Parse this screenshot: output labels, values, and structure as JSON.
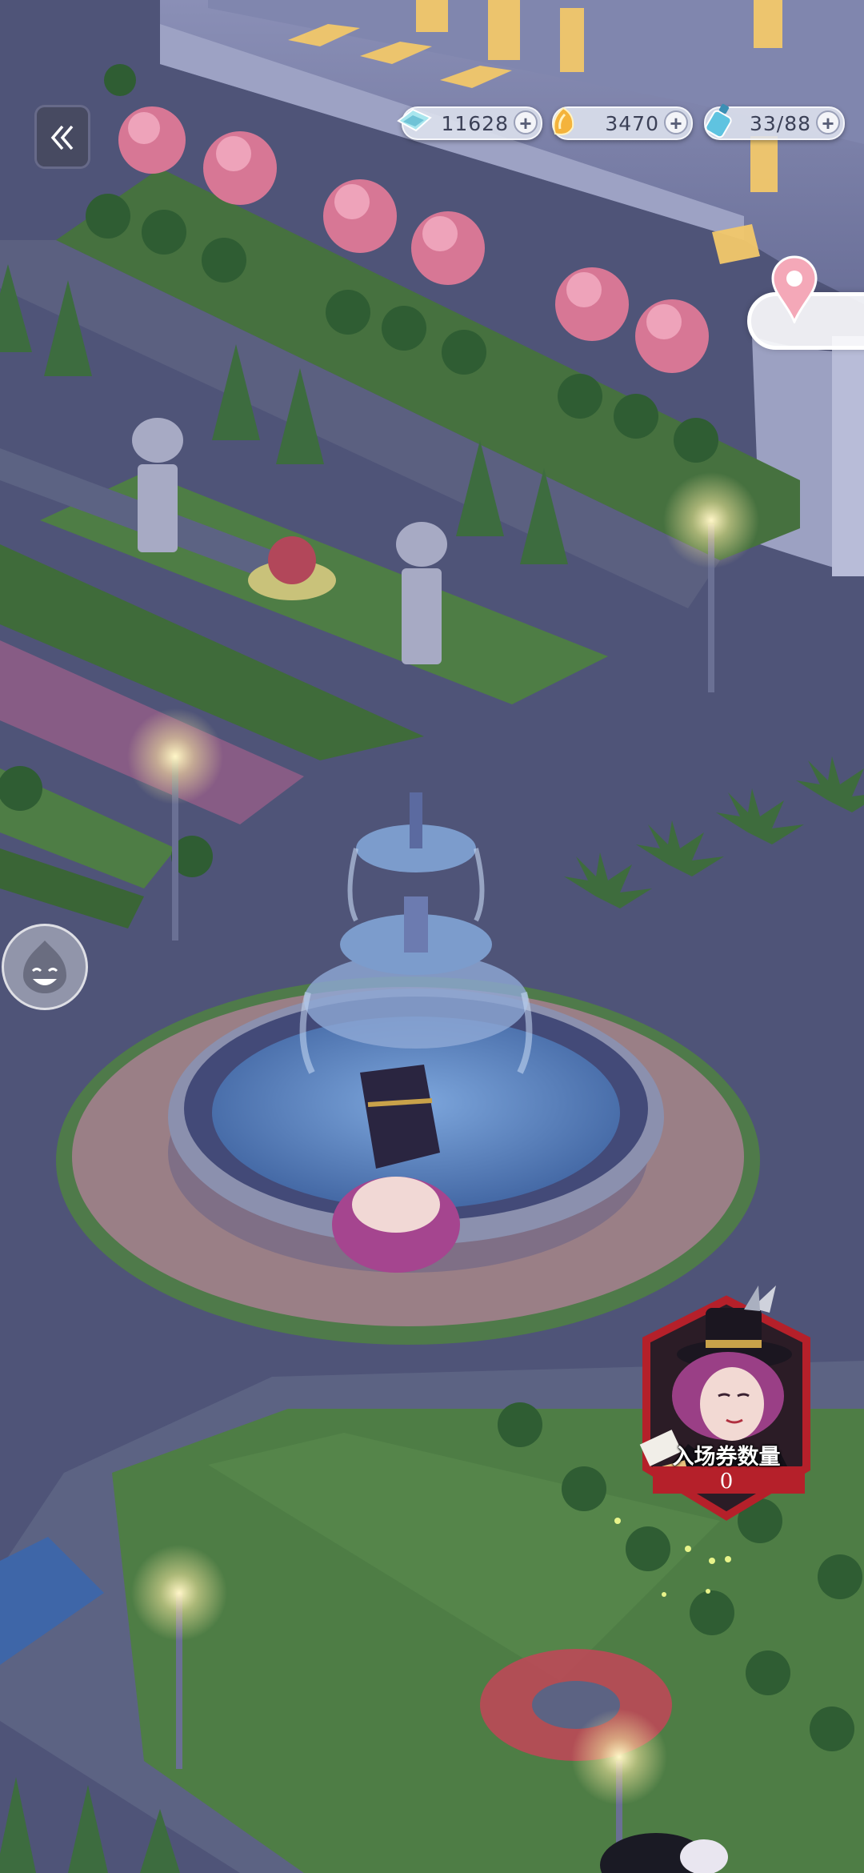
{
  "hud": {
    "diamonds": {
      "value": "11628",
      "icon": "diamond-ticket-icon"
    },
    "coins": {
      "value": "3470",
      "icon": "gold-coin-icon"
    },
    "stamina": {
      "value": "33/88",
      "icon": "energy-bottle-icon"
    },
    "add_symbol": "+"
  },
  "nav": {
    "back_icon": "double-chevron-left-icon"
  },
  "location_marker": {
    "icon": "map-pin-icon",
    "color": "#f4a8b8"
  },
  "emote_button": {
    "icon": "laughing-blob-icon"
  },
  "event_ticket": {
    "label": "入场券数量",
    "count": "0",
    "frame_color": "#b5202a"
  },
  "colors": {
    "night_ground": "#4f5478",
    "lawn": "#4f7a4a",
    "water": "#5e86c0",
    "blossom": "#d86a8c"
  }
}
